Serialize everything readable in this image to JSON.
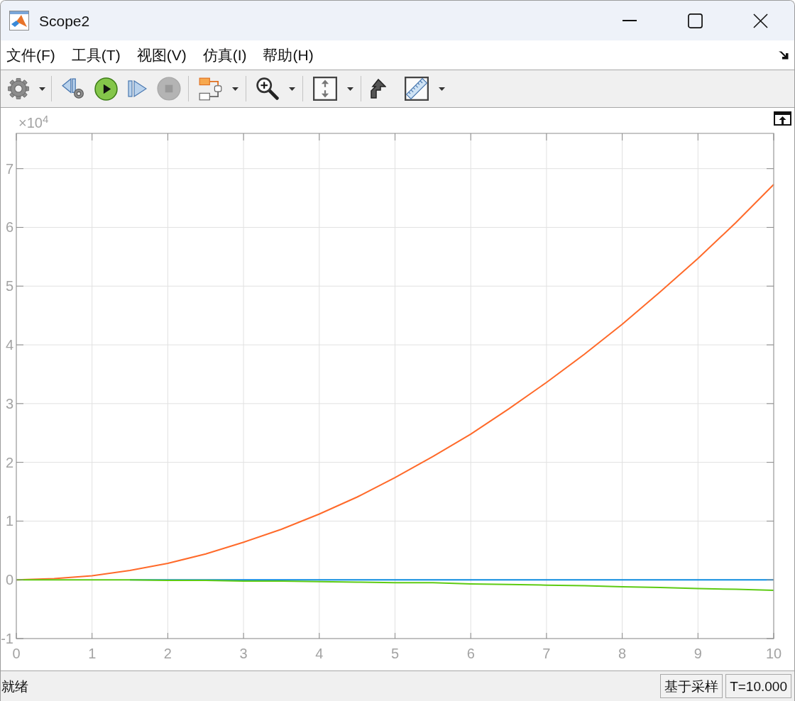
{
  "window": {
    "title": "Scope2"
  },
  "menu": [
    "文件(F)",
    "工具(T)",
    "视图(V)",
    "仿真(I)",
    "帮助(H)"
  ],
  "toolbar": {
    "groups": [
      [
        {
          "kind": "settings",
          "dropdown": true,
          "disabled": false
        }
      ],
      [
        {
          "kind": "step_back",
          "dropdown": false,
          "disabled": false
        },
        {
          "kind": "run",
          "dropdown": false,
          "disabled": false
        },
        {
          "kind": "step_forward",
          "dropdown": false,
          "disabled": false
        },
        {
          "kind": "stop",
          "dropdown": false,
          "disabled": true
        }
      ],
      [
        {
          "kind": "block_diagram",
          "dropdown": true,
          "disabled": false
        }
      ],
      [
        {
          "kind": "zoom",
          "dropdown": true,
          "disabled": false
        }
      ],
      [
        {
          "kind": "fit_axes",
          "dropdown": true,
          "disabled": false
        }
      ],
      [
        {
          "kind": "stepped_arrow",
          "dropdown": false,
          "disabled": false
        },
        {
          "kind": "ruler",
          "dropdown": true,
          "disabled": false
        }
      ]
    ]
  },
  "plot": {
    "y_multiplier": "×10$^{4}$",
    "chart_data": {
      "type": "line",
      "grid": true,
      "x": [
        0,
        0.5,
        1,
        1.5,
        2,
        2.5,
        3,
        3.5,
        4,
        4.5,
        5,
        5.5,
        6,
        6.5,
        7,
        7.5,
        8,
        8.5,
        9,
        9.5,
        10
      ],
      "series": [
        {
          "color": "#0e8de0",
          "values": [
            null,
            null,
            null,
            0,
            0,
            0,
            0,
            0,
            0,
            0,
            0,
            0,
            0,
            0,
            0,
            0,
            0,
            0,
            0,
            0,
            0
          ]
        },
        {
          "color": "#ff6a2a",
          "values": [
            0,
            0.02,
            0.07,
            0.16,
            0.28,
            0.44,
            0.64,
            0.86,
            1.12,
            1.41,
            1.74,
            2.1,
            2.48,
            2.91,
            3.36,
            3.84,
            4.35,
            4.9,
            5.47,
            6.08,
            6.73
          ]
        },
        {
          "color": "#5ecb14",
          "values": [
            0,
            0,
            0,
            0,
            -0.01,
            -0.01,
            -0.02,
            -0.02,
            -0.03,
            -0.04,
            -0.05,
            -0.05,
            -0.07,
            -0.08,
            -0.09,
            -0.1,
            -0.12,
            -0.13,
            -0.15,
            -0.16,
            -0.18
          ]
        }
      ],
      "xlim": [
        0,
        10
      ],
      "ylim": [
        -1,
        7.6
      ],
      "xticks": [
        0,
        1,
        2,
        3,
        4,
        5,
        6,
        7,
        8,
        9,
        10
      ],
      "yticks": [
        -1,
        0,
        1,
        2,
        3,
        4,
        5,
        6,
        7
      ]
    }
  },
  "status_bar": {
    "message": "就绪",
    "fields": [
      "基于采样",
      "T=10.000"
    ]
  }
}
